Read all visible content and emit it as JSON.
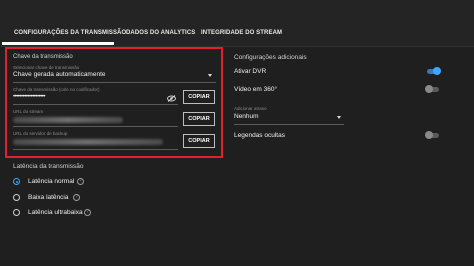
{
  "tabs": [
    {
      "label": "CONFIGURAÇÕES DA TRANSMISSÃO",
      "active": true
    },
    {
      "label": "DADOS DO ANALYTICS",
      "active": false
    },
    {
      "label": "INTEGRIDADE DO STREAM",
      "active": false
    }
  ],
  "stream_key": {
    "section_title": "Chave da transmissão",
    "select_label": "Selecionar chave de transmissão",
    "select_value": "Chave gerada automaticamente",
    "key_label": "Chave da transmissão (cole no codificador)",
    "key_value": "••••••••••••••••••••",
    "url_label": "URL do stream",
    "backup_label": "URL do servidor de backup",
    "copy_label": "COPIAR"
  },
  "additional": {
    "title": "Configurações adicionais",
    "dvr_label": "Ativar DVR",
    "dvr_on": true,
    "video360_label": "Vídeo em 360°",
    "video360_on": false,
    "delay_label": "Adicionar atraso",
    "delay_value": "Nenhum",
    "captions_label": "Legendas ocultas",
    "captions_on": false
  },
  "latency": {
    "title": "Latência da transmissão",
    "options": [
      {
        "label": "Latência normal",
        "selected": true
      },
      {
        "label": "Baixa latência",
        "selected": false
      },
      {
        "label": "Latência ultrabaixa",
        "selected": false
      }
    ]
  },
  "colors": {
    "accent": "#3ea6ff",
    "highlight": "#e0202d"
  }
}
